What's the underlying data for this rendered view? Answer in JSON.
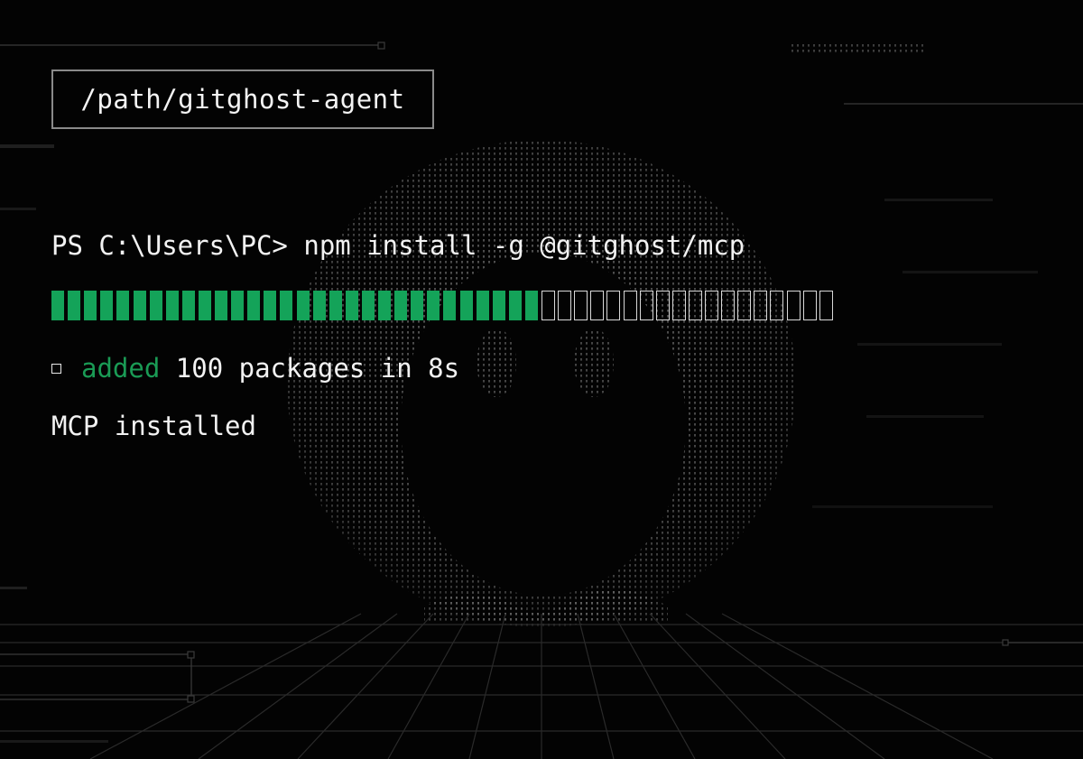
{
  "path_label": "/path/gitghost-agent",
  "terminal": {
    "prompt": "PS C:\\Users\\PC> ",
    "command": "npm install -g @gitghost/mcp",
    "progress": {
      "filled_segments": 30,
      "total_segments": 48,
      "fraction": 0.625
    },
    "added_word": "added",
    "added_rest": " 100 packages in 8s",
    "status": "MCP installed"
  },
  "colors": {
    "background": "#030303",
    "accent_green": "#14a359",
    "text": "#f2f2f2",
    "ghost_dots": "#9a9a9a"
  },
  "icons": {
    "bullet": "square-outline-icon",
    "mascot": "ghost-dot-art-icon"
  }
}
